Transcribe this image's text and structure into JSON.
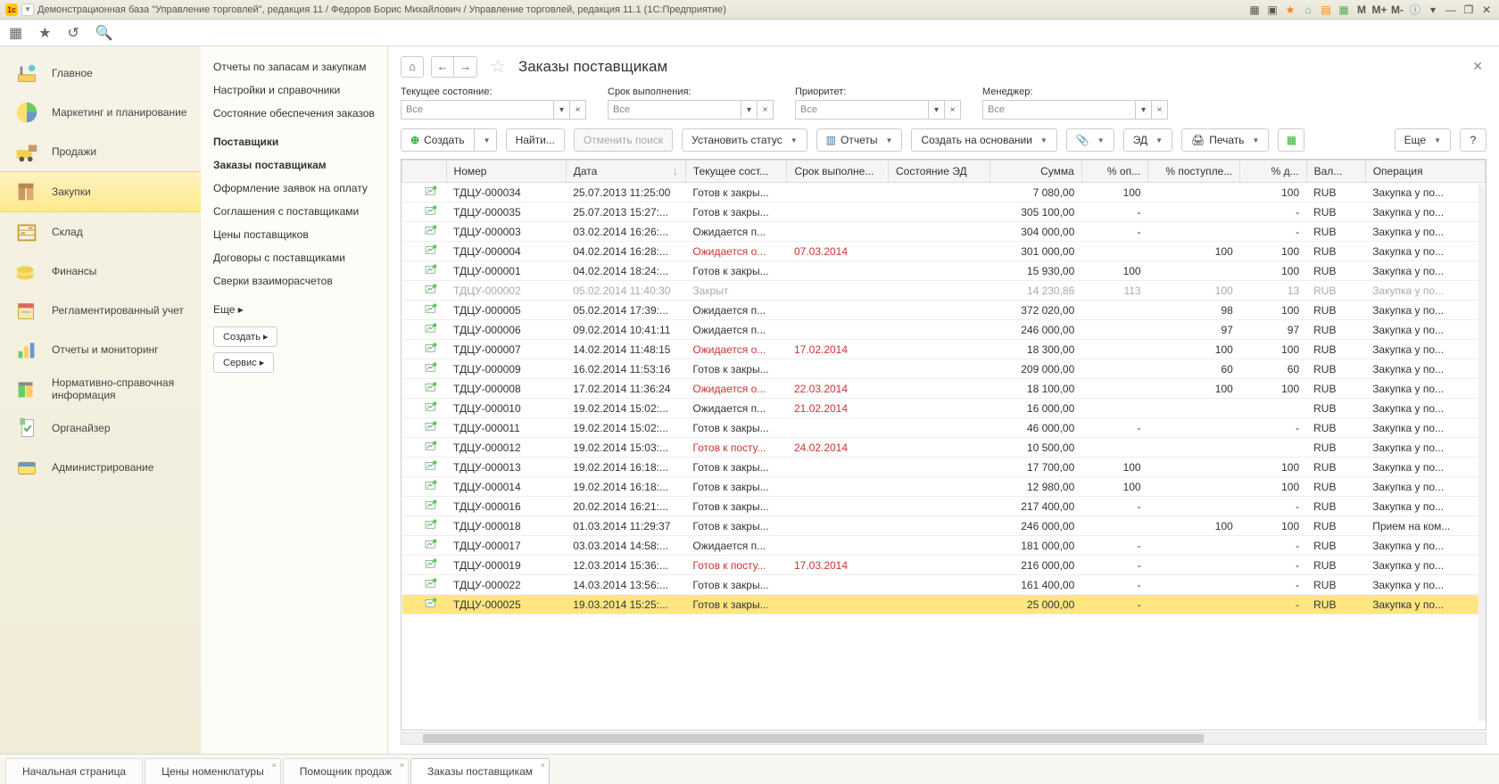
{
  "titlebar": {
    "text": "Демонстрационная база \"Управление торговлей\", редакция 11 / Федоров Борис Михайлович / Управление торговлей, редакция 11.1  (1С:Предприятие)",
    "m_labels": [
      "M",
      "M+",
      "M-"
    ]
  },
  "sidebar": {
    "items": [
      {
        "label": "Главное"
      },
      {
        "label": "Маркетинг и планирование"
      },
      {
        "label": "Продажи"
      },
      {
        "label": "Закупки"
      },
      {
        "label": "Склад"
      },
      {
        "label": "Финансы"
      },
      {
        "label": "Регламентированный учет"
      },
      {
        "label": "Отчеты и мониторинг"
      },
      {
        "label": "Нормативно-справочная информация"
      },
      {
        "label": "Органайзер"
      },
      {
        "label": "Администрирование"
      }
    ]
  },
  "sidebar2": {
    "items": [
      "Отчеты по запасам и закупкам",
      "Настройки и справочники",
      "Состояние обеспечения заказов",
      "Поставщики",
      "Заказы поставщикам",
      "Оформление заявок на оплату",
      "Соглашения с поставщиками",
      "Цены поставщиков",
      "Договоры с поставщиками",
      "Сверки взаиморасчетов"
    ],
    "more_label": "Еще",
    "create_label": "Создать",
    "service_label": "Сервис"
  },
  "page": {
    "title": "Заказы поставщикам"
  },
  "filters": {
    "f1": {
      "label": "Текущее состояние:",
      "value": "Все"
    },
    "f2": {
      "label": "Срок выполнения:",
      "value": "Все"
    },
    "f3": {
      "label": "Приоритет:",
      "value": "Все"
    },
    "f4": {
      "label": "Менеджер:",
      "value": "Все"
    }
  },
  "toolbar": {
    "create": "Создать",
    "find": "Найти...",
    "cancel_search": "Отменить поиск",
    "set_status": "Установить статус",
    "reports": "Отчеты",
    "create_based": "Создать на основании",
    "ed": "ЭД",
    "print": "Печать",
    "more": "Еще",
    "help": "?"
  },
  "table": {
    "columns": [
      "",
      "Номер",
      "Дата",
      "Текущее сост...",
      "Срок выполне...",
      "Состояние ЭД",
      "Сумма",
      "% оп...",
      "% поступле...",
      "% д...",
      "Вал...",
      "Операция"
    ],
    "rows": [
      {
        "num": "ТДЦУ-000034",
        "date": "25.07.2013 11:25:00",
        "state": "Готов к закры...",
        "due": "",
        "ed": "",
        "sum": "7 080,00",
        "op": "100",
        "post": "",
        "d": "100",
        "val": "RUB",
        "oper": "Закупка у по...",
        "red_state": false,
        "red_due": false,
        "closed": false,
        "sel": false
      },
      {
        "num": "ТДЦУ-000035",
        "date": "25.07.2013 15:27:...",
        "state": "Готов к закры...",
        "due": "",
        "ed": "",
        "sum": "305 100,00",
        "op": "-",
        "post": "",
        "d": "-",
        "val": "RUB",
        "oper": "Закупка у по...",
        "red_state": false,
        "red_due": false,
        "closed": false,
        "sel": false
      },
      {
        "num": "ТДЦУ-000003",
        "date": "03.02.2014 16:26:...",
        "state": "Ожидается п...",
        "due": "",
        "ed": "",
        "sum": "304 000,00",
        "op": "-",
        "post": "",
        "d": "-",
        "val": "RUB",
        "oper": "Закупка у по...",
        "red_state": false,
        "red_due": false,
        "closed": false,
        "sel": false
      },
      {
        "num": "ТДЦУ-000004",
        "date": "04.02.2014 16:28:...",
        "state": "Ожидается о...",
        "due": "07.03.2014",
        "ed": "",
        "sum": "301 000,00",
        "op": "",
        "post": "100",
        "d": "100",
        "val": "RUB",
        "oper": "Закупка у по...",
        "red_state": true,
        "red_due": true,
        "closed": false,
        "sel": false
      },
      {
        "num": "ТДЦУ-000001",
        "date": "04.02.2014 18:24:...",
        "state": "Готов к закры...",
        "due": "",
        "ed": "",
        "sum": "15 930,00",
        "op": "100",
        "post": "",
        "d": "100",
        "val": "RUB",
        "oper": "Закупка у по...",
        "red_state": false,
        "red_due": false,
        "closed": false,
        "sel": false
      },
      {
        "num": "ТДЦУ-000002",
        "date": "05.02.2014 11:40:30",
        "state": "Закрыт",
        "due": "",
        "ed": "",
        "sum": "14 230,86",
        "op": "113",
        "post": "100",
        "d": "13",
        "val": "RUB",
        "oper": "Закупка у по...",
        "red_state": false,
        "red_due": false,
        "closed": true,
        "sel": false
      },
      {
        "num": "ТДЦУ-000005",
        "date": "05.02.2014 17:39:...",
        "state": "Ожидается п...",
        "due": "",
        "ed": "",
        "sum": "372 020,00",
        "op": "",
        "post": "98",
        "d": "100",
        "val": "RUB",
        "oper": "Закупка у по...",
        "red_state": false,
        "red_due": false,
        "closed": false,
        "sel": false
      },
      {
        "num": "ТДЦУ-000006",
        "date": "09.02.2014 10:41:11",
        "state": "Ожидается п...",
        "due": "",
        "ed": "",
        "sum": "246 000,00",
        "op": "",
        "post": "97",
        "d": "97",
        "val": "RUB",
        "oper": "Закупка у по...",
        "red_state": false,
        "red_due": false,
        "closed": false,
        "sel": false
      },
      {
        "num": "ТДЦУ-000007",
        "date": "14.02.2014 11:48:15",
        "state": "Ожидается о...",
        "due": "17.02.2014",
        "ed": "",
        "sum": "18 300,00",
        "op": "",
        "post": "100",
        "d": "100",
        "val": "RUB",
        "oper": "Закупка у по...",
        "red_state": true,
        "red_due": true,
        "closed": false,
        "sel": false
      },
      {
        "num": "ТДЦУ-000009",
        "date": "16.02.2014 11:53:16",
        "state": "Готов к закры...",
        "due": "",
        "ed": "",
        "sum": "209 000,00",
        "op": "",
        "post": "60",
        "d": "60",
        "val": "RUB",
        "oper": "Закупка у по...",
        "red_state": false,
        "red_due": false,
        "closed": false,
        "sel": false
      },
      {
        "num": "ТДЦУ-000008",
        "date": "17.02.2014 11:36:24",
        "state": "Ожидается о...",
        "due": "22.03.2014",
        "ed": "",
        "sum": "18 100,00",
        "op": "",
        "post": "100",
        "d": "100",
        "val": "RUB",
        "oper": "Закупка у по...",
        "red_state": true,
        "red_due": true,
        "closed": false,
        "sel": false
      },
      {
        "num": "ТДЦУ-000010",
        "date": "19.02.2014 15:02:...",
        "state": "Ожидается п...",
        "due": "21.02.2014",
        "ed": "",
        "sum": "16 000,00",
        "op": "",
        "post": "",
        "d": "",
        "val": "RUB",
        "oper": "Закупка у по...",
        "red_state": false,
        "red_due": true,
        "closed": false,
        "sel": false
      },
      {
        "num": "ТДЦУ-000011",
        "date": "19.02.2014 15:02:...",
        "state": "Готов к закры...",
        "due": "",
        "ed": "",
        "sum": "46 000,00",
        "op": "-",
        "post": "",
        "d": "-",
        "val": "RUB",
        "oper": "Закупка у по...",
        "red_state": false,
        "red_due": false,
        "closed": false,
        "sel": false
      },
      {
        "num": "ТДЦУ-000012",
        "date": "19.02.2014 15:03:...",
        "state": "Готов к посту...",
        "due": "24.02.2014",
        "ed": "",
        "sum": "10 500,00",
        "op": "",
        "post": "",
        "d": "",
        "val": "RUB",
        "oper": "Закупка у по...",
        "red_state": true,
        "red_due": true,
        "closed": false,
        "sel": false
      },
      {
        "num": "ТДЦУ-000013",
        "date": "19.02.2014 16:18:...",
        "state": "Готов к закры...",
        "due": "",
        "ed": "",
        "sum": "17 700,00",
        "op": "100",
        "post": "",
        "d": "100",
        "val": "RUB",
        "oper": "Закупка у по...",
        "red_state": false,
        "red_due": false,
        "closed": false,
        "sel": false
      },
      {
        "num": "ТДЦУ-000014",
        "date": "19.02.2014 16:18:...",
        "state": "Готов к закры...",
        "due": "",
        "ed": "",
        "sum": "12 980,00",
        "op": "100",
        "post": "",
        "d": "100",
        "val": "RUB",
        "oper": "Закупка у по...",
        "red_state": false,
        "red_due": false,
        "closed": false,
        "sel": false
      },
      {
        "num": "ТДЦУ-000016",
        "date": "20.02.2014 16:21:...",
        "state": "Готов к закры...",
        "due": "",
        "ed": "",
        "sum": "217 400,00",
        "op": "-",
        "post": "",
        "d": "-",
        "val": "RUB",
        "oper": "Закупка у по...",
        "red_state": false,
        "red_due": false,
        "closed": false,
        "sel": false
      },
      {
        "num": "ТДЦУ-000018",
        "date": "01.03.2014 11:29:37",
        "state": "Готов к закры...",
        "due": "",
        "ed": "",
        "sum": "246 000,00",
        "op": "",
        "post": "100",
        "d": "100",
        "val": "RUB",
        "oper": "Прием на ком...",
        "red_state": false,
        "red_due": false,
        "closed": false,
        "sel": false
      },
      {
        "num": "ТДЦУ-000017",
        "date": "03.03.2014 14:58:...",
        "state": "Ожидается п...",
        "due": "",
        "ed": "",
        "sum": "181 000,00",
        "op": "-",
        "post": "",
        "d": "-",
        "val": "RUB",
        "oper": "Закупка у по...",
        "red_state": false,
        "red_due": false,
        "closed": false,
        "sel": false
      },
      {
        "num": "ТДЦУ-000019",
        "date": "12.03.2014 15:36:...",
        "state": "Готов к посту...",
        "due": "17.03.2014",
        "ed": "",
        "sum": "216 000,00",
        "op": "-",
        "post": "",
        "d": "-",
        "val": "RUB",
        "oper": "Закупка у по...",
        "red_state": true,
        "red_due": true,
        "closed": false,
        "sel": false
      },
      {
        "num": "ТДЦУ-000022",
        "date": "14.03.2014 13:56:...",
        "state": "Готов к закры...",
        "due": "",
        "ed": "",
        "sum": "161 400,00",
        "op": "-",
        "post": "",
        "d": "-",
        "val": "RUB",
        "oper": "Закупка у по...",
        "red_state": false,
        "red_due": false,
        "closed": false,
        "sel": false
      },
      {
        "num": "ТДЦУ-000025",
        "date": "19.03.2014 15:25:...",
        "state": "Готов к закры...",
        "due": "",
        "ed": "",
        "sum": "25 000,00",
        "op": "-",
        "post": "",
        "d": "-",
        "val": "RUB",
        "oper": "Закупка у по...",
        "red_state": false,
        "red_due": false,
        "closed": false,
        "sel": true
      }
    ]
  },
  "bottom_tabs": {
    "items": [
      {
        "label": "Начальная страница",
        "close": false
      },
      {
        "label": "Цены номенклатуры",
        "close": true
      },
      {
        "label": "Помощник продаж",
        "close": true
      },
      {
        "label": "Заказы поставщикам",
        "close": true
      }
    ]
  }
}
